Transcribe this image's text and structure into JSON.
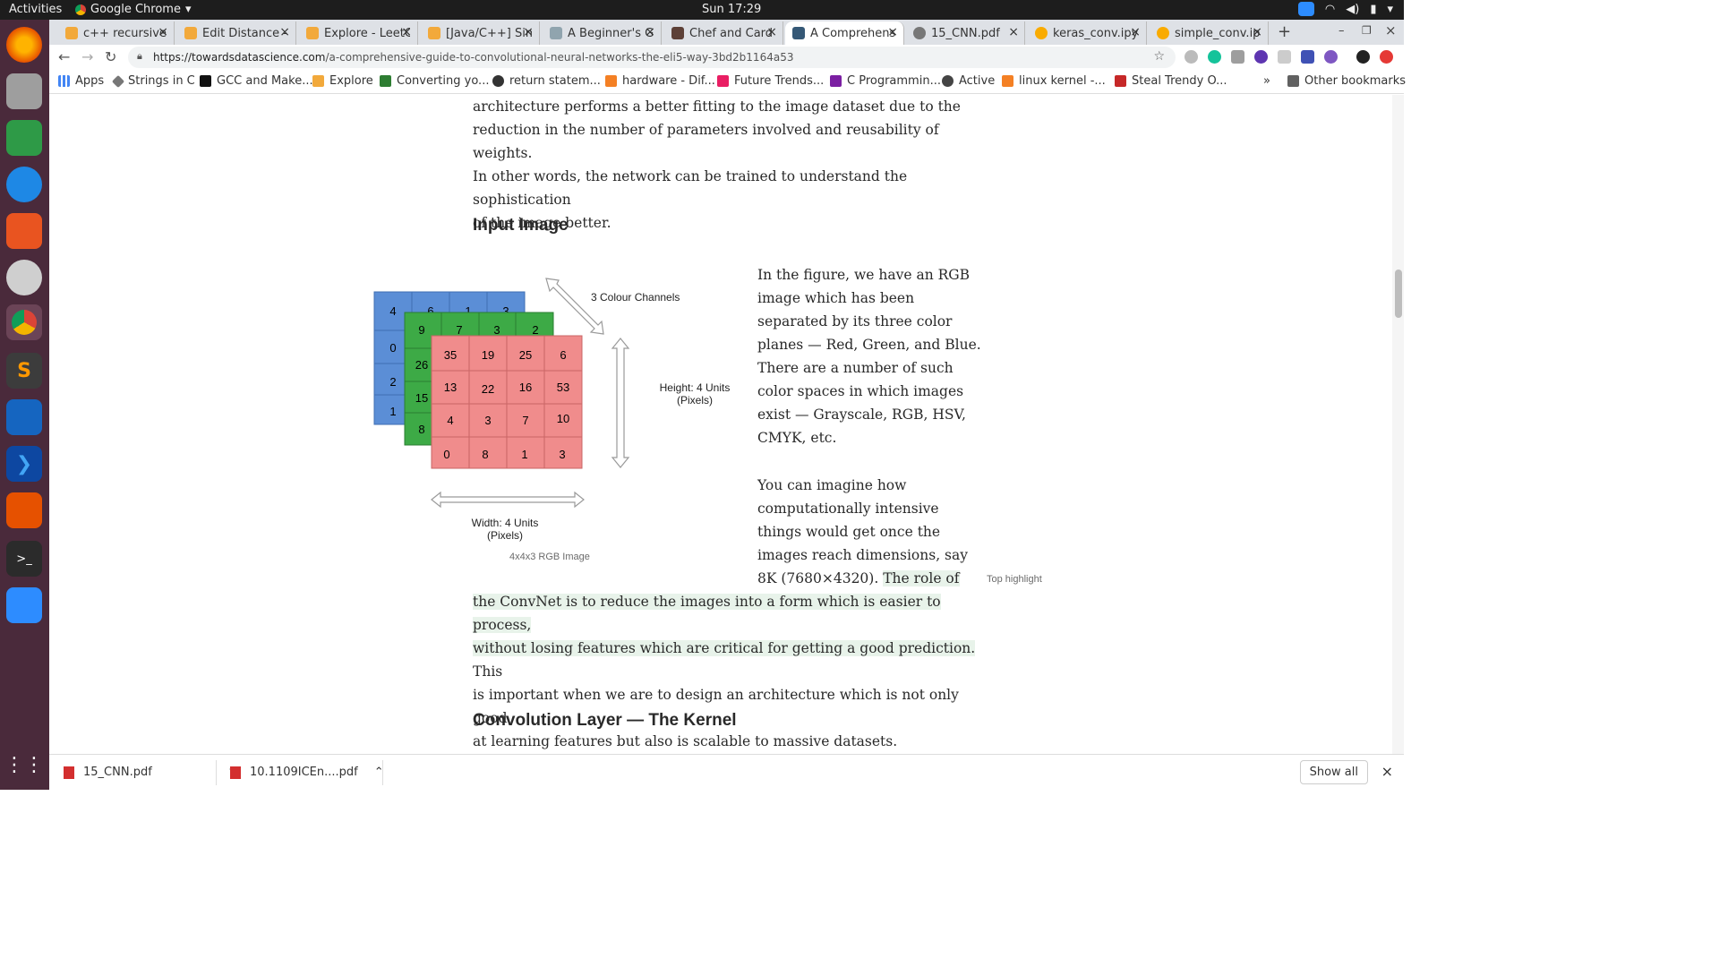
{
  "system": {
    "activities": "Activities",
    "app_name": "Google Chrome",
    "clock": "Sun 17:29"
  },
  "tabs": [
    {
      "label": "c++ recursive ,"
    },
    {
      "label": "Edit Distance -"
    },
    {
      "label": "Explore - LeetC"
    },
    {
      "label": "[Java/C++] Sim"
    },
    {
      "label": "A Beginner's G"
    },
    {
      "label": "Chef and Card"
    },
    {
      "label": "A Comprehens"
    },
    {
      "label": "15_CNN.pdf"
    },
    {
      "label": "keras_conv.ipy"
    },
    {
      "label": "simple_conv.ip"
    }
  ],
  "address": {
    "host": "https://towardsdatascience.com",
    "path": "/a-comprehensive-guide-to-convolutional-neural-networks-the-eli5-way-3bd2b1164a53"
  },
  "bookmarks": [
    {
      "label": "Apps"
    },
    {
      "label": "Strings in C"
    },
    {
      "label": "GCC and Make..."
    },
    {
      "label": "Explore"
    },
    {
      "label": "Converting yo..."
    },
    {
      "label": "return statem..."
    },
    {
      "label": "hardware - Dif..."
    },
    {
      "label": "Future Trends..."
    },
    {
      "label": "C Programmin..."
    },
    {
      "label": "Active"
    },
    {
      "label": "linux kernel -..."
    },
    {
      "label": "Steal Trendy O..."
    }
  ],
  "bookmarks_more": "»",
  "other_bookmarks": "Other bookmarks",
  "article": {
    "para_top": [
      "architecture performs a better fitting to the image dataset due to the",
      "reduction in the number of parameters involved and reusability of weights.",
      "In other words, the network can be trained to understand the sophistication",
      "of the image better."
    ],
    "heading_input": "Input Image",
    "side_para1": [
      "In the figure, we have an RGB",
      "image which has been",
      "separated by its three color",
      "planes — Red, Green, and Blue.",
      "There are a number of such",
      "color spaces in which images",
      "exist — Grayscale, RGB, HSV,",
      "CMYK, etc."
    ],
    "side_para2": [
      "You can imagine how",
      "computationally intensive",
      "things would get once the",
      "images reach dimensions, say"
    ],
    "side_para2_last_plain": "8K (7680×4320). ",
    "side_para2_last_hl": "The role of",
    "para_bottom_hl1": "the ConvNet is to reduce the images into a form which is easier to process,",
    "para_bottom_hl2": "without losing features which are critical for getting a good prediction.",
    "para_bottom_hl2_rest": " This",
    "para_bottom_rest": [
      "is important when we are to design an architecture which is not only good",
      "at learning features but also is scalable to massive datasets."
    ],
    "top_highlight": "Top highlight",
    "heading_conv": "Convolution Layer — The Kernel"
  },
  "figure": {
    "blue_top": [
      "4",
      "6",
      "1",
      "3"
    ],
    "blue_left": [
      "0",
      "2",
      "1"
    ],
    "green_top": [
      "9",
      "7",
      "3",
      "2"
    ],
    "green_left": [
      "26",
      "15",
      "8"
    ],
    "red_grid": [
      [
        "35",
        "19",
        "25",
        "6"
      ],
      [
        "13",
        "22",
        "16",
        "53"
      ],
      [
        "4",
        "3",
        "7",
        "10"
      ],
      [
        "0",
        "8",
        "1",
        "3"
      ]
    ],
    "channels_label": "3 Colour Channels",
    "height_label": "Height: 4 Units",
    "height_sub": "(Pixels)",
    "width_label": "Width: 4 Units",
    "width_sub": "(Pixels)",
    "caption": "4x4x3 RGB Image",
    "colors": {
      "blue": "#5b8ed6",
      "green": "#3daa46",
      "red": "#f08c8c"
    }
  },
  "downloads": [
    {
      "name": "15_CNN.pdf"
    },
    {
      "name": "10.1109ICEn....pdf"
    }
  ],
  "show_all": "Show all"
}
